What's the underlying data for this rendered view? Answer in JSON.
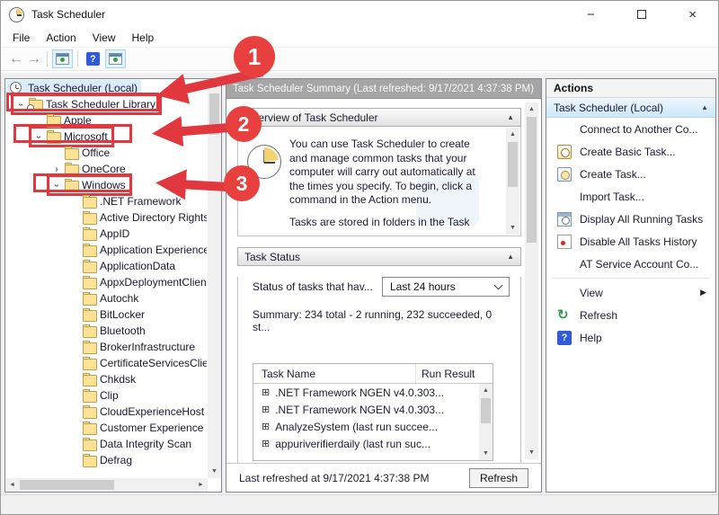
{
  "window": {
    "title": "Task Scheduler",
    "minimize": "−",
    "close": "×"
  },
  "menu": {
    "items": [
      "File",
      "Action",
      "View",
      "Help"
    ]
  },
  "tree": {
    "items": [
      {
        "label": "Task Scheduler (Local)",
        "level": 0,
        "chevron": "none",
        "icon": "clock",
        "selected": true
      },
      {
        "label": "Task Scheduler Library",
        "level": 1,
        "chevron": "expanded",
        "icon": "folder-clock",
        "boxed": true
      },
      {
        "label": "Apple",
        "level": 2,
        "chevron": "none",
        "icon": "folder"
      },
      {
        "label": "Microsoft",
        "level": 2,
        "chevron": "expanded",
        "icon": "folder",
        "boxed": true
      },
      {
        "label": "Office",
        "level": 3,
        "chevron": "none",
        "icon": "folder"
      },
      {
        "label": "OneCore",
        "level": 3,
        "chevron": "collapsed",
        "icon": "folder"
      },
      {
        "label": "Windows",
        "level": 3,
        "chevron": "expanded",
        "icon": "folder",
        "boxed": true
      },
      {
        "label": ".NET Framework",
        "level": 4,
        "chevron": "none",
        "icon": "folder"
      },
      {
        "label": "Active Directory Rights",
        "level": 4,
        "chevron": "none",
        "icon": "folder"
      },
      {
        "label": "AppID",
        "level": 4,
        "chevron": "none",
        "icon": "folder"
      },
      {
        "label": "Application Experience",
        "level": 4,
        "chevron": "none",
        "icon": "folder"
      },
      {
        "label": "ApplicationData",
        "level": 4,
        "chevron": "none",
        "icon": "folder"
      },
      {
        "label": "AppxDeploymentClient",
        "level": 4,
        "chevron": "none",
        "icon": "folder"
      },
      {
        "label": "Autochk",
        "level": 4,
        "chevron": "none",
        "icon": "folder"
      },
      {
        "label": "BitLocker",
        "level": 4,
        "chevron": "none",
        "icon": "folder"
      },
      {
        "label": "Bluetooth",
        "level": 4,
        "chevron": "none",
        "icon": "folder"
      },
      {
        "label": "BrokerInfrastructure",
        "level": 4,
        "chevron": "none",
        "icon": "folder"
      },
      {
        "label": "CertificateServicesClient",
        "level": 4,
        "chevron": "none",
        "icon": "folder"
      },
      {
        "label": "Chkdsk",
        "level": 4,
        "chevron": "none",
        "icon": "folder"
      },
      {
        "label": "Clip",
        "level": 4,
        "chevron": "none",
        "icon": "folder"
      },
      {
        "label": "CloudExperienceHost",
        "level": 4,
        "chevron": "none",
        "icon": "folder"
      },
      {
        "label": "Customer Experience Improvement",
        "level": 4,
        "chevron": "none",
        "icon": "folder"
      },
      {
        "label": "Data Integrity Scan",
        "level": 4,
        "chevron": "none",
        "icon": "folder"
      },
      {
        "label": "Defrag",
        "level": 4,
        "chevron": "none",
        "icon": "folder"
      }
    ]
  },
  "summary": {
    "header": "Task Scheduler Summary (Last refreshed: 9/17/2021 4:37:38 PM)",
    "overview": {
      "title": "Overview of Task Scheduler",
      "paragraph1": "You can use Task Scheduler to create and manage common tasks that your computer will carry out automatically at the times you specify. To begin, click a command in the Action menu.",
      "paragraph2": "Tasks are stored in folders in the Task"
    },
    "task_status": {
      "title": "Task Status",
      "filter_label": "Status of tasks that hav...",
      "filter_value": "Last 24 hours",
      "summary_line": "Summary: 234 total - 2 running, 232 succeeded, 0 st...",
      "columns": [
        "Task Name",
        "Run Result"
      ],
      "rows": [
        ".NET Framework NGEN v4.0.303...",
        ".NET Framework NGEN v4.0.303...",
        "AnalyzeSystem (last run succee...",
        "appuriverifierdaily (last run suc..."
      ]
    },
    "footer": {
      "refreshed_text": "Last refreshed at 9/17/2021 4:37:38 PM",
      "refresh_button": "Refresh"
    }
  },
  "actions": {
    "title": "Actions",
    "group": "Task Scheduler (Local)",
    "items": [
      {
        "label": "Connect to Another Co..."
      },
      {
        "label": "Create Basic Task...",
        "icon": "create-basic-task-icon"
      },
      {
        "label": "Create Task...",
        "icon": "create-task-icon"
      },
      {
        "label": "Import Task..."
      },
      {
        "label": "Display All Running Tasks",
        "icon": "display-running-tasks-icon"
      },
      {
        "label": "Disable All Tasks History",
        "icon": "disable-history-icon"
      },
      {
        "label": "AT Service Account Co..."
      },
      {
        "separator": true
      },
      {
        "label": "View",
        "submenu": true
      },
      {
        "label": "Refresh",
        "icon": "refresh-icon"
      },
      {
        "label": "Help",
        "icon": "help-icon"
      }
    ]
  },
  "annotations": {
    "steps": [
      "1",
      "2",
      "3"
    ],
    "color": "#e8403f"
  }
}
